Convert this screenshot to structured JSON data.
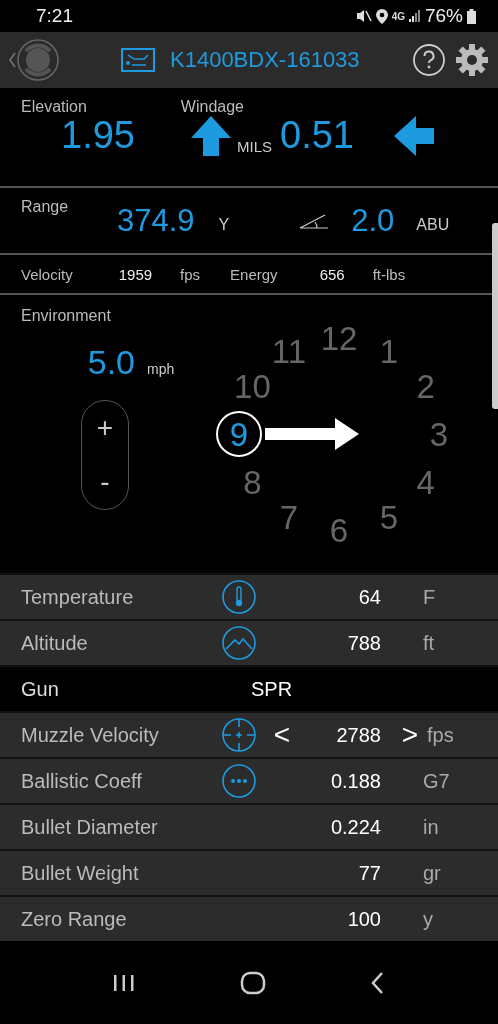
{
  "status_bar": {
    "time": "7:21",
    "network": "4G",
    "battery": "76%"
  },
  "header": {
    "device": "K1400BDX-161033"
  },
  "solution": {
    "elevation": {
      "label": "Elevation",
      "value": "1.95",
      "kind": "up"
    },
    "windage": {
      "label": "Windage",
      "value": "0.51",
      "kind": "left"
    },
    "unit": "MILS"
  },
  "range": {
    "label": "Range",
    "value": "374.9",
    "unit": "Y",
    "angle": "2.0",
    "angle_unit": "ABU"
  },
  "velocity": {
    "label": "Velocity",
    "value": "1959",
    "unit": "fps",
    "energy_label": "Energy",
    "energy": "656",
    "energy_unit": "ft-lbs"
  },
  "environment": {
    "label": "Environment",
    "wind_speed": "5.0",
    "wind_unit": "mph",
    "plus": "+",
    "minus": "-",
    "clock": [
      {
        "label": "12",
        "selected": false
      },
      {
        "label": "11",
        "selected": false
      },
      {
        "label": "1",
        "selected": false
      },
      {
        "label": "10",
        "selected": false
      },
      {
        "label": "2",
        "selected": false
      },
      {
        "label": "9",
        "selected": true
      },
      {
        "label": "3",
        "selected": false
      },
      {
        "label": "8",
        "selected": false
      },
      {
        "label": "4",
        "selected": false
      },
      {
        "label": "7",
        "selected": false
      },
      {
        "label": "5",
        "selected": false
      },
      {
        "label": "6",
        "selected": false
      }
    ]
  },
  "settings": [
    {
      "kind": "temperature",
      "label": "Temperature",
      "value": "64",
      "unit": "F"
    },
    {
      "kind": "altitude",
      "label": "Altitude",
      "value": "788",
      "unit": "ft"
    },
    {
      "kind": "header",
      "label": "Gun",
      "value": "SPR"
    },
    {
      "kind": "stepper",
      "label": "Muzzle Velocity",
      "value": "2788",
      "unit": "fps",
      "prev": "<",
      "next": ">"
    },
    {
      "kind": "coefficient",
      "label": "Ballistic Coeff",
      "value": "0.188",
      "unit": "G7"
    },
    {
      "kind": "plain",
      "label": "Bullet Diameter",
      "value": "0.224",
      "unit": "in"
    },
    {
      "kind": "plain",
      "label": "Bullet Weight",
      "value": "77",
      "unit": "gr"
    },
    {
      "kind": "plain",
      "label": "Zero Range",
      "value": "100",
      "unit": "y"
    }
  ]
}
